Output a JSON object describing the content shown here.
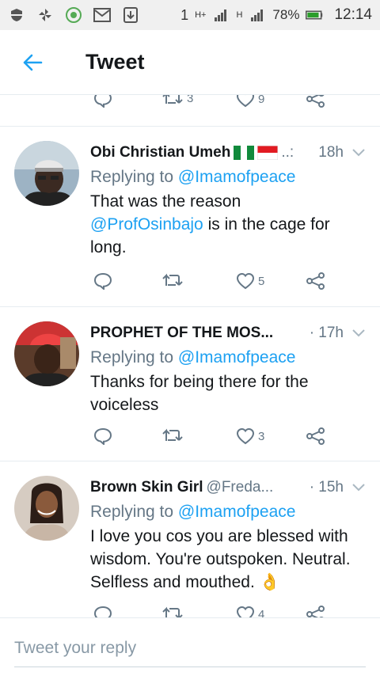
{
  "status_bar": {
    "signal_left": "1",
    "network_1": "H+",
    "network_2": "H",
    "battery_pct": "78%",
    "time": "12:14"
  },
  "header": {
    "title": "Tweet"
  },
  "top_actions": {
    "retweets": "3",
    "likes": "9"
  },
  "tweets": [
    {
      "name": "Obi Christian Umeh",
      "handle": "..:",
      "time": "18h",
      "reply_prefix": "Replying to",
      "reply_to": "@Imamofpeace",
      "text_mention": "@ProfOsinbajo",
      "text_before": "That was the reason",
      "text_after": "is in the cage for long.",
      "likes": "5"
    },
    {
      "name": "PROPHET OF THE MOS...",
      "handle": "",
      "time": "· 17h",
      "reply_prefix": "Replying to",
      "reply_to": "@Imamofpeace",
      "text": "Thanks for being there for the voiceless",
      "likes": "3"
    },
    {
      "name": "Brown Skin Girl",
      "handle": "@Freda...",
      "time": "· 15h",
      "reply_prefix": "Replying to",
      "reply_to": "@Imamofpeace",
      "text": "I love you cos you are blessed with wisdom. You're outspoken. Neutral. Selfless and mouthed.",
      "emoji": "👌",
      "likes": "4"
    }
  ],
  "reply_bar": {
    "placeholder": "Tweet your reply"
  },
  "colors": {
    "accent": "#1da1f2",
    "muted": "#657786",
    "text": "#14171a"
  }
}
